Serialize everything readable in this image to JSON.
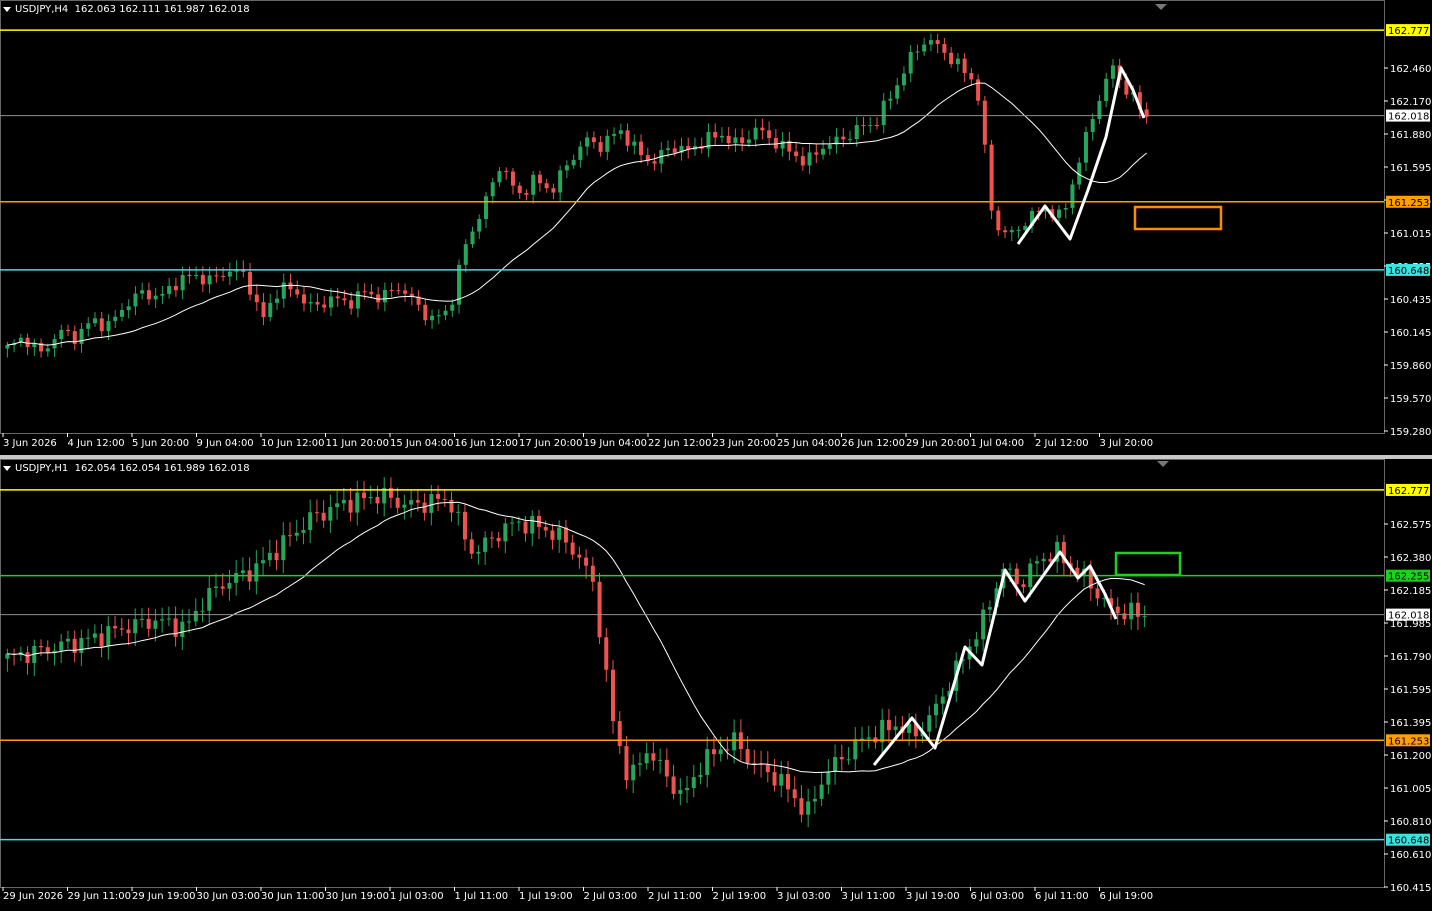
{
  "colors": {
    "background": "#000000",
    "bull": "#26a65b",
    "bear": "#ef5350",
    "ma": "#ffffff",
    "grid_text": "#ffffff",
    "yellow": "#ffff00",
    "orange": "#ffa000",
    "cyan": "#40e0e0",
    "green": "#20d020",
    "gray": "#909090"
  },
  "panels": [
    {
      "id": "h4",
      "header": {
        "symbol": "USDJPY,H4",
        "ohlc": "162.063 162.111 161.987 162.018"
      },
      "y_ticks": [
        "162.460",
        "162.170",
        "161.880",
        "161.595",
        "161.305",
        "161.015",
        "160.725",
        "160.435",
        "160.145",
        "159.860",
        "159.570",
        "159.280"
      ],
      "x_ticks": [
        "3 Jun 2026",
        "4 Jun 12:00",
        "5 Jun 20:00",
        "9 Jun 04:00",
        "10 Jun 12:00",
        "11 Jun 20:00",
        "15 Jun 04:00",
        "16 Jun 12:00",
        "17 Jun 20:00",
        "19 Jun 04:00",
        "22 Jun 12:00",
        "23 Jun 20:00",
        "25 Jun 04:00",
        "26 Jun 12:00",
        "29 Jun 20:00",
        "1 Jul 04:00",
        "2 Jul 12:00",
        "3 Jul 20:00"
      ],
      "levels": [
        {
          "price": "162.777",
          "color": "#ffff00",
          "text": "#000000"
        },
        {
          "price": "162.018",
          "color": "#909090",
          "text": "#000000",
          "bg": "#ffffff"
        },
        {
          "price": "161.253",
          "color": "#ffa000",
          "text": "#000000"
        },
        {
          "price": "160.648",
          "color": "#40e0e0",
          "text": "#000000"
        }
      ],
      "price_range": [
        159.2,
        162.92
      ],
      "zone": {
        "color": "#ff8c00"
      }
    },
    {
      "id": "h1",
      "header": {
        "symbol": "USDJPY,H1",
        "ohlc": "162.054 162.054 161.989 162.018"
      },
      "y_ticks": [
        "162.575",
        "162.380",
        "162.185",
        "161.985",
        "161.790",
        "161.595",
        "161.395",
        "161.200",
        "161.005",
        "160.810",
        "160.610",
        "160.415"
      ],
      "x_ticks": [
        "29 Jun 2026",
        "29 Jun 11:00",
        "29 Jun 19:00",
        "30 Jun 03:00",
        "30 Jun 11:00",
        "30 Jun 19:00",
        "1 Jul 03:00",
        "1 Jul 11:00",
        "1 Jul 19:00",
        "2 Jul 03:00",
        "2 Jul 11:00",
        "2 Jul 19:00",
        "3 Jul 03:00",
        "3 Jul 11:00",
        "3 Jul 19:00",
        "6 Jul 03:00",
        "6 Jul 11:00",
        "6 Jul 19:00"
      ],
      "levels": [
        {
          "price": "162.777",
          "color": "#ffff00",
          "text": "#000000"
        },
        {
          "price": "162.255",
          "color": "#20d020",
          "text": "#000000"
        },
        {
          "price": "162.018",
          "color": "#909090",
          "text": "#000000",
          "bg": "#ffffff"
        },
        {
          "price": "161.253",
          "color": "#ffa000",
          "text": "#000000"
        },
        {
          "price": "160.648",
          "color": "#40e0e0",
          "text": "#000000"
        }
      ],
      "price_range": [
        160.36,
        162.88
      ],
      "zone": {
        "color": "#20d020"
      }
    }
  ],
  "chart_data": [
    {
      "type": "candlestick",
      "title": "USDJPY,H4",
      "close_path": [
        159.95,
        160.05,
        159.9,
        160.1,
        160.05,
        160.2,
        160.15,
        160.35,
        160.45,
        160.4,
        160.55,
        160.6,
        160.55,
        160.65,
        160.6,
        160.2,
        160.5,
        160.45,
        160.3,
        160.4,
        160.35,
        160.45,
        160.4,
        160.5,
        160.35,
        160.2,
        160.3,
        160.9,
        161.2,
        161.6,
        161.3,
        161.45,
        161.35,
        161.6,
        161.8,
        161.75,
        161.9,
        161.7,
        161.6,
        161.75,
        161.7,
        161.8,
        161.85,
        161.75,
        161.9,
        161.8,
        161.7,
        161.6,
        161.75,
        161.8,
        161.9,
        161.95,
        162.2,
        162.5,
        162.7,
        162.6,
        162.45,
        162.3,
        161.05,
        160.95,
        161.1,
        161.2,
        161.1,
        161.6,
        162.1,
        162.45,
        162.2,
        162.018
      ]
    },
    {
      "type": "candlestick",
      "title": "USDJPY,H1",
      "close_path": [
        161.75,
        161.78,
        161.8,
        161.83,
        161.85,
        161.88,
        161.92,
        161.95,
        161.98,
        161.97,
        161.93,
        162.1,
        162.2,
        162.25,
        162.3,
        162.4,
        162.5,
        162.6,
        162.65,
        162.7,
        162.72,
        162.75,
        162.7,
        162.68,
        162.72,
        162.7,
        162.4,
        162.45,
        162.55,
        162.58,
        162.55,
        162.5,
        162.4,
        162.2,
        161.4,
        161.0,
        161.2,
        161.05,
        160.9,
        161.1,
        161.2,
        161.25,
        161.1,
        161.05,
        160.95,
        160.8,
        161.05,
        161.15,
        161.25,
        161.3,
        161.35,
        161.28,
        161.4,
        161.6,
        161.8,
        162.0,
        162.3,
        162.2,
        162.35,
        162.4,
        162.3,
        162.2,
        162.05,
        162.03,
        162.018
      ]
    }
  ]
}
